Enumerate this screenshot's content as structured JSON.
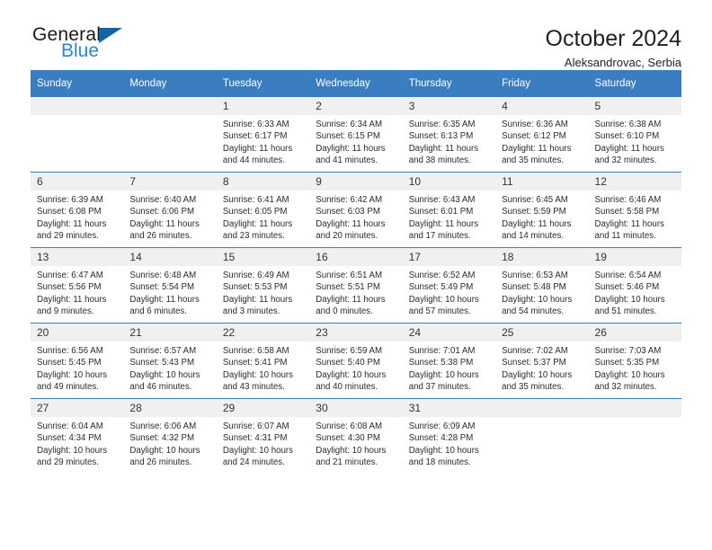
{
  "brand": {
    "name_top": "General",
    "name_bottom": "Blue",
    "triangle_color": "#1464a5",
    "blue_text_color": "#2a86d6"
  },
  "header": {
    "title": "October 2024",
    "subtitle": "Aleksandrovac, Serbia"
  },
  "theme": {
    "header_blue": "#3a7dc0",
    "daynum_band": "#f0f0f0",
    "text": "#2b2b2b"
  },
  "weekday_headers": [
    "Sunday",
    "Monday",
    "Tuesday",
    "Wednesday",
    "Thursday",
    "Friday",
    "Saturday"
  ],
  "weeks": [
    [
      {
        "day": "",
        "blank": true
      },
      {
        "day": "",
        "blank": true
      },
      {
        "day": "1",
        "sunrise": "Sunrise: 6:33 AM",
        "sunset": "Sunset: 6:17 PM",
        "daylight": "Daylight: 11 hours and 44 minutes."
      },
      {
        "day": "2",
        "sunrise": "Sunrise: 6:34 AM",
        "sunset": "Sunset: 6:15 PM",
        "daylight": "Daylight: 11 hours and 41 minutes."
      },
      {
        "day": "3",
        "sunrise": "Sunrise: 6:35 AM",
        "sunset": "Sunset: 6:13 PM",
        "daylight": "Daylight: 11 hours and 38 minutes."
      },
      {
        "day": "4",
        "sunrise": "Sunrise: 6:36 AM",
        "sunset": "Sunset: 6:12 PM",
        "daylight": "Daylight: 11 hours and 35 minutes."
      },
      {
        "day": "5",
        "sunrise": "Sunrise: 6:38 AM",
        "sunset": "Sunset: 6:10 PM",
        "daylight": "Daylight: 11 hours and 32 minutes."
      }
    ],
    [
      {
        "day": "6",
        "sunrise": "Sunrise: 6:39 AM",
        "sunset": "Sunset: 6:08 PM",
        "daylight": "Daylight: 11 hours and 29 minutes."
      },
      {
        "day": "7",
        "sunrise": "Sunrise: 6:40 AM",
        "sunset": "Sunset: 6:06 PM",
        "daylight": "Daylight: 11 hours and 26 minutes."
      },
      {
        "day": "8",
        "sunrise": "Sunrise: 6:41 AM",
        "sunset": "Sunset: 6:05 PM",
        "daylight": "Daylight: 11 hours and 23 minutes."
      },
      {
        "day": "9",
        "sunrise": "Sunrise: 6:42 AM",
        "sunset": "Sunset: 6:03 PM",
        "daylight": "Daylight: 11 hours and 20 minutes."
      },
      {
        "day": "10",
        "sunrise": "Sunrise: 6:43 AM",
        "sunset": "Sunset: 6:01 PM",
        "daylight": "Daylight: 11 hours and 17 minutes."
      },
      {
        "day": "11",
        "sunrise": "Sunrise: 6:45 AM",
        "sunset": "Sunset: 5:59 PM",
        "daylight": "Daylight: 11 hours and 14 minutes."
      },
      {
        "day": "12",
        "sunrise": "Sunrise: 6:46 AM",
        "sunset": "Sunset: 5:58 PM",
        "daylight": "Daylight: 11 hours and 11 minutes."
      }
    ],
    [
      {
        "day": "13",
        "sunrise": "Sunrise: 6:47 AM",
        "sunset": "Sunset: 5:56 PM",
        "daylight": "Daylight: 11 hours and 9 minutes."
      },
      {
        "day": "14",
        "sunrise": "Sunrise: 6:48 AM",
        "sunset": "Sunset: 5:54 PM",
        "daylight": "Daylight: 11 hours and 6 minutes."
      },
      {
        "day": "15",
        "sunrise": "Sunrise: 6:49 AM",
        "sunset": "Sunset: 5:53 PM",
        "daylight": "Daylight: 11 hours and 3 minutes."
      },
      {
        "day": "16",
        "sunrise": "Sunrise: 6:51 AM",
        "sunset": "Sunset: 5:51 PM",
        "daylight": "Daylight: 11 hours and 0 minutes."
      },
      {
        "day": "17",
        "sunrise": "Sunrise: 6:52 AM",
        "sunset": "Sunset: 5:49 PM",
        "daylight": "Daylight: 10 hours and 57 minutes."
      },
      {
        "day": "18",
        "sunrise": "Sunrise: 6:53 AM",
        "sunset": "Sunset: 5:48 PM",
        "daylight": "Daylight: 10 hours and 54 minutes."
      },
      {
        "day": "19",
        "sunrise": "Sunrise: 6:54 AM",
        "sunset": "Sunset: 5:46 PM",
        "daylight": "Daylight: 10 hours and 51 minutes."
      }
    ],
    [
      {
        "day": "20",
        "sunrise": "Sunrise: 6:56 AM",
        "sunset": "Sunset: 5:45 PM",
        "daylight": "Daylight: 10 hours and 49 minutes."
      },
      {
        "day": "21",
        "sunrise": "Sunrise: 6:57 AM",
        "sunset": "Sunset: 5:43 PM",
        "daylight": "Daylight: 10 hours and 46 minutes."
      },
      {
        "day": "22",
        "sunrise": "Sunrise: 6:58 AM",
        "sunset": "Sunset: 5:41 PM",
        "daylight": "Daylight: 10 hours and 43 minutes."
      },
      {
        "day": "23",
        "sunrise": "Sunrise: 6:59 AM",
        "sunset": "Sunset: 5:40 PM",
        "daylight": "Daylight: 10 hours and 40 minutes."
      },
      {
        "day": "24",
        "sunrise": "Sunrise: 7:01 AM",
        "sunset": "Sunset: 5:38 PM",
        "daylight": "Daylight: 10 hours and 37 minutes."
      },
      {
        "day": "25",
        "sunrise": "Sunrise: 7:02 AM",
        "sunset": "Sunset: 5:37 PM",
        "daylight": "Daylight: 10 hours and 35 minutes."
      },
      {
        "day": "26",
        "sunrise": "Sunrise: 7:03 AM",
        "sunset": "Sunset: 5:35 PM",
        "daylight": "Daylight: 10 hours and 32 minutes."
      }
    ],
    [
      {
        "day": "27",
        "sunrise": "Sunrise: 6:04 AM",
        "sunset": "Sunset: 4:34 PM",
        "daylight": "Daylight: 10 hours and 29 minutes."
      },
      {
        "day": "28",
        "sunrise": "Sunrise: 6:06 AM",
        "sunset": "Sunset: 4:32 PM",
        "daylight": "Daylight: 10 hours and 26 minutes."
      },
      {
        "day": "29",
        "sunrise": "Sunrise: 6:07 AM",
        "sunset": "Sunset: 4:31 PM",
        "daylight": "Daylight: 10 hours and 24 minutes."
      },
      {
        "day": "30",
        "sunrise": "Sunrise: 6:08 AM",
        "sunset": "Sunset: 4:30 PM",
        "daylight": "Daylight: 10 hours and 21 minutes."
      },
      {
        "day": "31",
        "sunrise": "Sunrise: 6:09 AM",
        "sunset": "Sunset: 4:28 PM",
        "daylight": "Daylight: 10 hours and 18 minutes."
      },
      {
        "day": "",
        "blank": true
      },
      {
        "day": "",
        "blank": true
      }
    ]
  ]
}
